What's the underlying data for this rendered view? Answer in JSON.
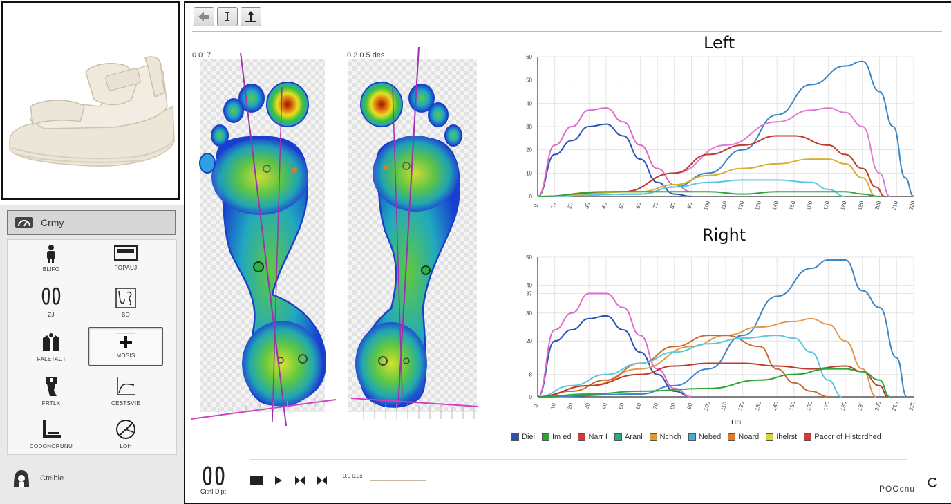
{
  "sidebar": {
    "header_label": "Crmy",
    "tools": [
      {
        "label": "BLIFO",
        "icon": "person-icon"
      },
      {
        "label": "FOPAUJ",
        "icon": "platform-icon"
      },
      {
        "label": "ZJ",
        "icon": "footprints-icon"
      },
      {
        "label": "BO",
        "icon": "foot-outline-icon"
      },
      {
        "label": "FALETAL I",
        "icon": "body-scan-icon"
      },
      {
        "label": "MOSIS",
        "icon": "plus-icon"
      },
      {
        "label": "FRTLK",
        "icon": "leg-icon"
      },
      {
        "label": "CESTSVIE",
        "icon": "curve-chart-icon"
      },
      {
        "label": "CODONORUNU",
        "icon": "l-chart-icon"
      },
      {
        "label": "LOH",
        "icon": "gauge-icon"
      }
    ],
    "footer_label": "Ctelble"
  },
  "main": {
    "left_time": "0 017",
    "right_time": "0 2.0 5 des",
    "chart_left_title": "Left",
    "chart_right_title": "Right",
    "x_axis_label": "na",
    "legend": [
      {
        "label": "Diel",
        "color": "#2a4fb8"
      },
      {
        "label": "Im ed",
        "color": "#2fa43a"
      },
      {
        "label": "Narr I",
        "color": "#d03a3a"
      },
      {
        "label": "Aranl",
        "color": "#27b07c"
      },
      {
        "label": "Nchch",
        "color": "#d8a02a"
      },
      {
        "label": "Nebed",
        "color": "#4aa8e0"
      },
      {
        "label": "Noard",
        "color": "#e07a2a"
      },
      {
        "label": "Ihelrst",
        "color": "#e0d040"
      },
      {
        "label": "Paocr of Histcrdhed",
        "color": "#d03a3a"
      }
    ],
    "playback": {
      "time_label": "0.0 0.0s",
      "right_label": "POOcnu",
      "footprint_label": "Citrtl Dipt"
    }
  },
  "chart_data": [
    {
      "type": "line",
      "title": "Left",
      "xlabel": "",
      "ylabel": "",
      "y_ticks": [
        0,
        10,
        20,
        30,
        40,
        50,
        60
      ],
      "ylim": [
        0,
        60
      ],
      "xlim": [
        0,
        22
      ],
      "series": [
        {
          "color": "#2a4fb8",
          "points": [
            [
              0,
              0
            ],
            [
              1,
              18
            ],
            [
              2,
              24
            ],
            [
              3,
              30
            ],
            [
              4,
              31
            ],
            [
              5,
              26
            ],
            [
              6,
              16
            ],
            [
              7,
              6
            ],
            [
              8,
              1
            ],
            [
              9,
              0
            ]
          ]
        },
        {
          "color": "#e06ac8",
          "points": [
            [
              0,
              0
            ],
            [
              1,
              22
            ],
            [
              2,
              30
            ],
            [
              3,
              37
            ],
            [
              4,
              38
            ],
            [
              5,
              32
            ],
            [
              6,
              22
            ],
            [
              7,
              12
            ],
            [
              8,
              5
            ],
            [
              9,
              2
            ]
          ]
        },
        {
          "color": "#3a86c8",
          "points": [
            [
              0,
              0
            ],
            [
              6,
              1
            ],
            [
              8,
              4
            ],
            [
              10,
              10
            ],
            [
              12,
              20
            ],
            [
              14,
              35
            ],
            [
              16,
              48
            ],
            [
              18,
              56
            ],
            [
              19,
              58
            ],
            [
              20,
              45
            ],
            [
              20.8,
              30
            ],
            [
              21.5,
              8
            ],
            [
              22,
              0
            ]
          ]
        },
        {
          "color": "#e07ad0",
          "points": [
            [
              0,
              0
            ],
            [
              5,
              2
            ],
            [
              8,
              10
            ],
            [
              11,
              22
            ],
            [
              14,
              32
            ],
            [
              16,
              37
            ],
            [
              17,
              38
            ],
            [
              18,
              36
            ],
            [
              19,
              30
            ],
            [
              20,
              10
            ],
            [
              20.6,
              0
            ]
          ]
        },
        {
          "color": "#c03a2a",
          "points": [
            [
              0,
              0
            ],
            [
              5,
              2
            ],
            [
              8,
              10
            ],
            [
              10,
              18
            ],
            [
              12,
              22
            ],
            [
              14,
              26
            ],
            [
              15,
              26
            ],
            [
              17,
              22
            ],
            [
              18,
              18
            ],
            [
              19,
              12
            ],
            [
              19.8,
              4
            ],
            [
              20.3,
              0
            ]
          ]
        },
        {
          "color": "#d8b030",
          "points": [
            [
              0,
              0
            ],
            [
              6,
              2
            ],
            [
              8,
              5
            ],
            [
              10,
              9
            ],
            [
              12,
              12
            ],
            [
              14,
              14
            ],
            [
              16,
              16
            ],
            [
              17,
              16
            ],
            [
              18,
              14
            ],
            [
              19,
              8
            ],
            [
              19.8,
              0
            ]
          ]
        },
        {
          "color": "#5cc8e0",
          "points": [
            [
              0,
              0
            ],
            [
              6,
              1
            ],
            [
              8,
              4
            ],
            [
              10,
              6
            ],
            [
              12,
              7
            ],
            [
              14,
              7
            ],
            [
              16,
              6
            ],
            [
              17,
              3
            ],
            [
              18,
              0
            ]
          ]
        },
        {
          "color": "#2fa43a",
          "points": [
            [
              0,
              0
            ],
            [
              4,
              2
            ],
            [
              6,
              2
            ],
            [
              8,
              2
            ],
            [
              10,
              2
            ],
            [
              12,
              1
            ],
            [
              14,
              2
            ],
            [
              16,
              2
            ],
            [
              18,
              2
            ],
            [
              19,
              1
            ],
            [
              20,
              0
            ]
          ]
        }
      ]
    },
    {
      "type": "line",
      "title": "Right",
      "xlabel": "na",
      "ylabel": "",
      "y_ticks": [
        0,
        8,
        20,
        30,
        37,
        40,
        50
      ],
      "ylim": [
        0,
        50
      ],
      "xlim": [
        0,
        22
      ],
      "series": [
        {
          "color": "#2a4fb8",
          "points": [
            [
              0,
              0
            ],
            [
              1,
              20
            ],
            [
              2,
              24
            ],
            [
              3,
              28
            ],
            [
              4,
              29
            ],
            [
              5,
              24
            ],
            [
              6,
              16
            ],
            [
              7,
              8
            ],
            [
              8,
              2
            ],
            [
              9,
              0
            ]
          ]
        },
        {
          "color": "#e06ac8",
          "points": [
            [
              0,
              0
            ],
            [
              1,
              24
            ],
            [
              2,
              30
            ],
            [
              3,
              37
            ],
            [
              4,
              37
            ],
            [
              5,
              32
            ],
            [
              6,
              22
            ],
            [
              7,
              10
            ],
            [
              8,
              3
            ],
            [
              9,
              0
            ]
          ]
        },
        {
          "color": "#3a86c8",
          "points": [
            [
              0,
              0
            ],
            [
              6,
              1
            ],
            [
              8,
              4
            ],
            [
              10,
              10
            ],
            [
              12,
              22
            ],
            [
              14,
              36
            ],
            [
              16,
              46
            ],
            [
              17,
              49
            ],
            [
              18,
              49
            ],
            [
              19,
              38
            ],
            [
              20,
              32
            ],
            [
              21,
              14
            ],
            [
              21.6,
              0
            ]
          ]
        },
        {
          "color": "#e09a50",
          "points": [
            [
              0,
              0
            ],
            [
              3,
              4
            ],
            [
              6,
              10
            ],
            [
              9,
              18
            ],
            [
              11,
              22
            ],
            [
              13,
              25
            ],
            [
              15,
              27
            ],
            [
              16,
              28
            ],
            [
              17,
              26
            ],
            [
              18,
              20
            ],
            [
              19,
              10
            ],
            [
              19.8,
              0
            ]
          ]
        },
        {
          "color": "#c86a2a",
          "points": [
            [
              0,
              0
            ],
            [
              2,
              2
            ],
            [
              4,
              6
            ],
            [
              6,
              12
            ],
            [
              8,
              18
            ],
            [
              10,
              22
            ],
            [
              11,
              22
            ],
            [
              13,
              18
            ],
            [
              14,
              10
            ],
            [
              15,
              5
            ],
            [
              16,
              2
            ],
            [
              17,
              0
            ]
          ]
        },
        {
          "color": "#5cc8e0",
          "points": [
            [
              0,
              0
            ],
            [
              2,
              4
            ],
            [
              4,
              8
            ],
            [
              6,
              12
            ],
            [
              8,
              16
            ],
            [
              10,
              19
            ],
            [
              12,
              21
            ],
            [
              14,
              22
            ],
            [
              15,
              21
            ],
            [
              16,
              16
            ],
            [
              17,
              6
            ],
            [
              17.8,
              0
            ]
          ]
        },
        {
          "color": "#c03a2a",
          "points": [
            [
              0,
              0
            ],
            [
              3,
              4
            ],
            [
              6,
              8
            ],
            [
              8,
              11
            ],
            [
              10,
              12
            ],
            [
              12,
              12
            ],
            [
              14,
              11
            ],
            [
              16,
              10
            ],
            [
              18,
              11
            ],
            [
              19,
              9
            ],
            [
              20,
              4
            ],
            [
              20.5,
              0
            ]
          ]
        },
        {
          "color": "#2fa43a",
          "points": [
            [
              0,
              0
            ],
            [
              3,
              1
            ],
            [
              6,
              2
            ],
            [
              10,
              3
            ],
            [
              13,
              6
            ],
            [
              15,
              8
            ],
            [
              17,
              10
            ],
            [
              18,
              10
            ],
            [
              19,
              9
            ],
            [
              20,
              6
            ],
            [
              20.6,
              0
            ]
          ]
        }
      ]
    }
  ]
}
